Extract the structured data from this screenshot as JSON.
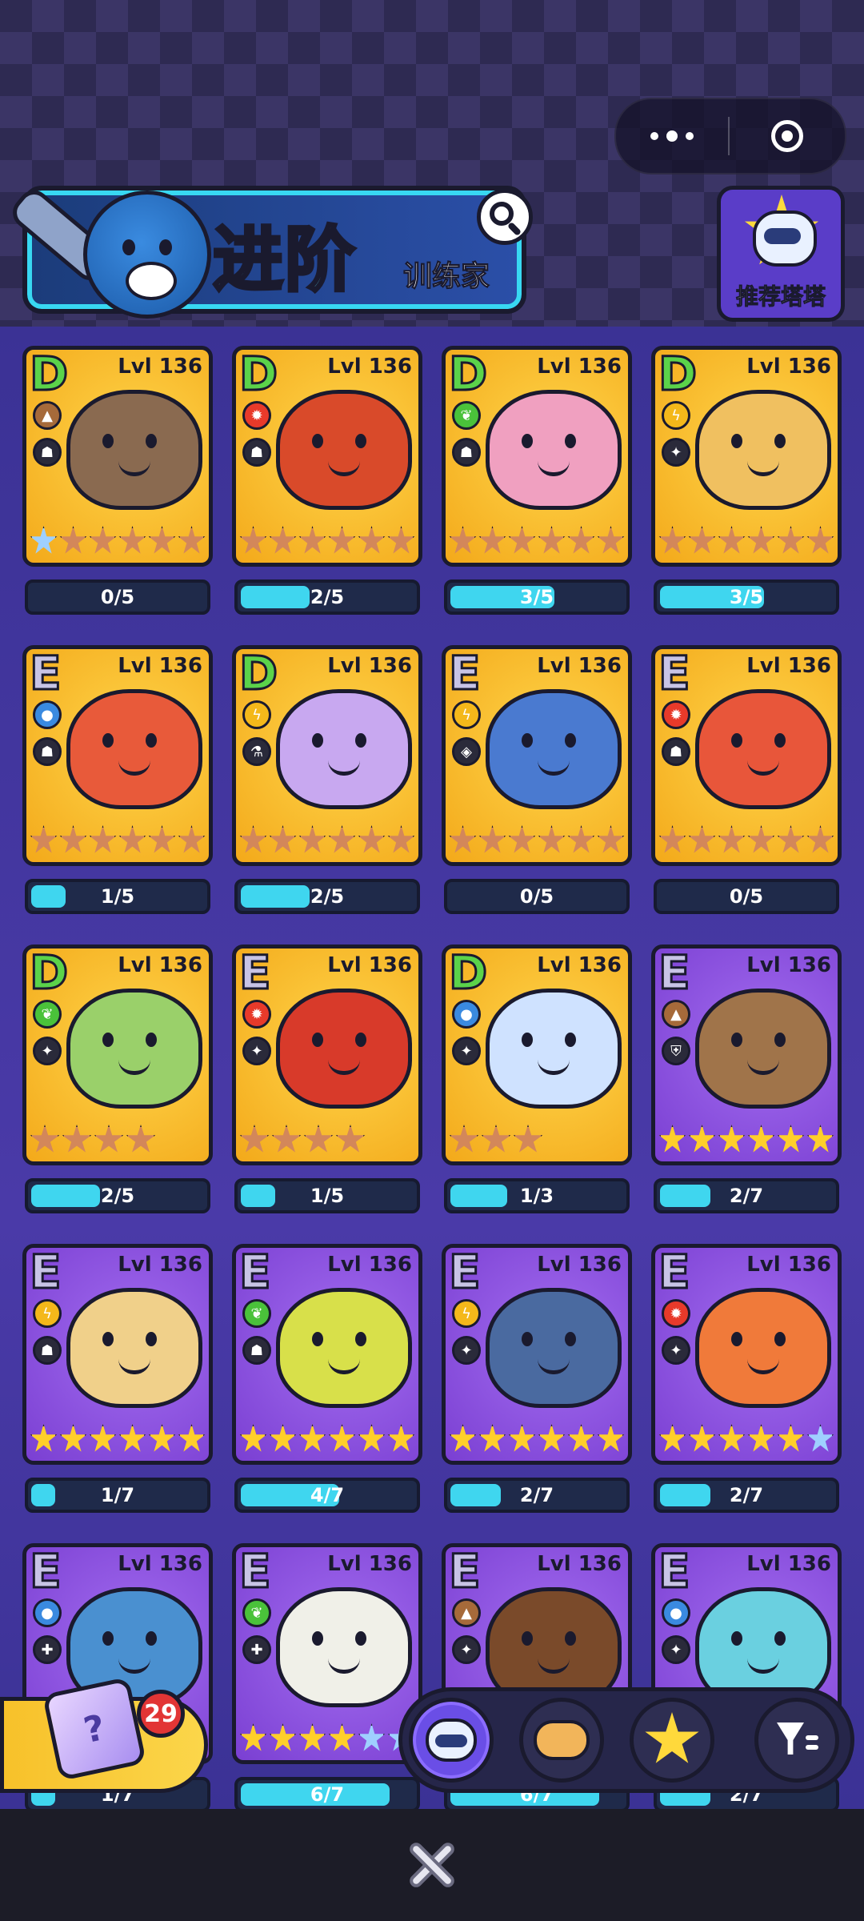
{
  "header": {
    "title": "进阶",
    "subtitle": "训练家",
    "recommend_label": "推荐塔塔"
  },
  "cards": [
    {
      "tier": "D",
      "level": "Lvl 136",
      "bg": "gold",
      "elem": "earth",
      "elem_color": "#a66a3a",
      "role": "defend",
      "creature_color": "#8a6a50",
      "stars": [
        "blue",
        "bronze",
        "bronze",
        "bronze",
        "bronze",
        "bronze"
      ],
      "progress_text": "0/5",
      "progress": 0
    },
    {
      "tier": "D",
      "level": "Lvl 136",
      "bg": "gold",
      "elem": "fire",
      "elem_color": "#e83a2a",
      "role": "defend",
      "creature_color": "#d94a2a",
      "stars": [
        "bronze",
        "bronze",
        "bronze",
        "bronze",
        "bronze",
        "bronze"
      ],
      "progress_text": "2/5",
      "progress": 0.4
    },
    {
      "tier": "D",
      "level": "Lvl 136",
      "bg": "gold",
      "elem": "grass",
      "elem_color": "#4ac23a",
      "role": "defend",
      "creature_color": "#f0a0c0",
      "stars": [
        "bronze",
        "bronze",
        "bronze",
        "bronze",
        "bronze",
        "bronze"
      ],
      "progress_text": "3/5",
      "progress": 0.6
    },
    {
      "tier": "D",
      "level": "Lvl 136",
      "bg": "gold",
      "elem": "electric",
      "elem_color": "#f4b81a",
      "role": "attack",
      "creature_color": "#f0c060",
      "stars": [
        "bronze",
        "bronze",
        "bronze",
        "bronze",
        "bronze",
        "bronze"
      ],
      "progress_text": "3/5",
      "progress": 0.6
    },
    {
      "tier": "E",
      "level": "Lvl 136",
      "bg": "gold",
      "elem": "water",
      "elem_color": "#3a8ae0",
      "role": "defend",
      "creature_color": "#e85a3a",
      "stars": [
        "bronze",
        "bronze",
        "bronze",
        "bronze",
        "bronze",
        "bronze"
      ],
      "progress_text": "1/5",
      "progress": 0.2
    },
    {
      "tier": "D",
      "level": "Lvl 136",
      "bg": "gold",
      "elem": "electric",
      "elem_color": "#f4b81a",
      "role": "support",
      "creature_color": "#c8a8f0",
      "stars": [
        "bronze",
        "bronze",
        "bronze",
        "bronze",
        "bronze",
        "bronze"
      ],
      "progress_text": "2/5",
      "progress": 0.4
    },
    {
      "tier": "E",
      "level": "Lvl 136",
      "bg": "gold",
      "elem": "electric",
      "elem_color": "#f4b81a",
      "role": "control",
      "creature_color": "#4a7ad0",
      "stars": [
        "bronze",
        "bronze",
        "bronze",
        "bronze",
        "bronze",
        "bronze"
      ],
      "progress_text": "0/5",
      "progress": 0
    },
    {
      "tier": "E",
      "level": "Lvl 136",
      "bg": "gold",
      "elem": "fire",
      "elem_color": "#e83a2a",
      "role": "defend",
      "creature_color": "#e8563a",
      "stars": [
        "bronze",
        "bronze",
        "bronze",
        "bronze",
        "bronze",
        "bronze"
      ],
      "progress_text": "0/5",
      "progress": 0
    },
    {
      "tier": "D",
      "level": "Lvl 136",
      "bg": "gold",
      "elem": "grass",
      "elem_color": "#4ac23a",
      "role": "attack",
      "creature_color": "#9ad06a",
      "stars": [
        "bronze",
        "bronze",
        "bronze",
        "bronze"
      ],
      "progress_text": "2/5",
      "progress": 0.4
    },
    {
      "tier": "E",
      "level": "Lvl 136",
      "bg": "gold",
      "elem": "fire",
      "elem_color": "#e83a2a",
      "role": "attack",
      "creature_color": "#d83a2a",
      "stars": [
        "bronze",
        "bronze",
        "bronze",
        "bronze"
      ],
      "progress_text": "1/5",
      "progress": 0.2
    },
    {
      "tier": "D",
      "level": "Lvl 136",
      "bg": "gold",
      "elem": "water",
      "elem_color": "#3a8ae0",
      "role": "attack",
      "creature_color": "#cfe2ff",
      "stars": [
        "bronze",
        "bronze",
        "bronze"
      ],
      "progress_text": "1/3",
      "progress": 0.33
    },
    {
      "tier": "E",
      "level": "Lvl 136",
      "bg": "purple",
      "elem": "earth",
      "elem_color": "#a66a3a",
      "role": "shield",
      "creature_color": "#a0744a",
      "stars": [
        "gold",
        "gold",
        "gold",
        "gold",
        "gold",
        "gold"
      ],
      "progress_text": "2/7",
      "progress": 0.29
    },
    {
      "tier": "E",
      "level": "Lvl 136",
      "bg": "purple",
      "elem": "electric",
      "elem_color": "#f4b81a",
      "role": "defend",
      "creature_color": "#f0d08a",
      "stars": [
        "gold",
        "gold",
        "gold",
        "gold",
        "gold",
        "gold"
      ],
      "progress_text": "1/7",
      "progress": 0.14
    },
    {
      "tier": "E",
      "level": "Lvl 136",
      "bg": "purple",
      "elem": "grass",
      "elem_color": "#4ac23a",
      "role": "defend",
      "creature_color": "#d8e04a",
      "stars": [
        "gold",
        "gold",
        "gold",
        "gold",
        "gold",
        "gold"
      ],
      "progress_text": "4/7",
      "progress": 0.57
    },
    {
      "tier": "E",
      "level": "Lvl 136",
      "bg": "purple",
      "elem": "electric",
      "elem_color": "#f4b81a",
      "role": "attack",
      "creature_color": "#4a6aa0",
      "stars": [
        "gold",
        "gold",
        "gold",
        "gold",
        "gold",
        "gold"
      ],
      "progress_text": "2/7",
      "progress": 0.29
    },
    {
      "tier": "E",
      "level": "Lvl 136",
      "bg": "purple",
      "elem": "fire",
      "elem_color": "#e83a2a",
      "role": "attack",
      "creature_color": "#f07a3a",
      "stars": [
        "gold",
        "gold",
        "gold",
        "gold",
        "gold",
        "blue"
      ],
      "progress_text": "2/7",
      "progress": 0.29
    },
    {
      "tier": "E",
      "level": "Lvl 136",
      "bg": "purple",
      "elem": "water",
      "elem_color": "#3a8ae0",
      "role": "heal",
      "creature_color": "#4a90d0",
      "stars": [
        "gold",
        "gold",
        "gold",
        "gold",
        "gold",
        "gold"
      ],
      "progress_text": "1/7",
      "progress": 0.14
    },
    {
      "tier": "E",
      "level": "Lvl 136",
      "bg": "purple",
      "elem": "grass",
      "elem_color": "#4ac23a",
      "role": "heal",
      "creature_color": "#f0f0e8",
      "stars": [
        "gold",
        "gold",
        "gold",
        "gold",
        "blue",
        "blue"
      ],
      "progress_text": "6/7",
      "progress": 0.86
    },
    {
      "tier": "E",
      "level": "Lvl 136",
      "bg": "purple",
      "elem": "earth",
      "elem_color": "#a66a3a",
      "role": "attack",
      "creature_color": "#7a4a2a",
      "stars": [
        "gold",
        "gold",
        "gold",
        "gold",
        "gold",
        "gold"
      ],
      "progress_text": "6/7",
      "progress": 0.86
    },
    {
      "tier": "E",
      "level": "Lvl 136",
      "bg": "purple",
      "elem": "water",
      "elem_color": "#3a8ae0",
      "role": "attack",
      "creature_color": "#6ad0e0",
      "stars": [
        "gold",
        "gold",
        "gold",
        "gold",
        "gold",
        "gold"
      ],
      "progress_text": "2/7",
      "progress": 0.29
    }
  ],
  "dice": {
    "badge_count": "29",
    "icon_text": "?"
  },
  "filters": {
    "items": [
      "cat-tab",
      "bread-tab",
      "star-tab",
      "filter"
    ],
    "active": "cat-tab"
  }
}
